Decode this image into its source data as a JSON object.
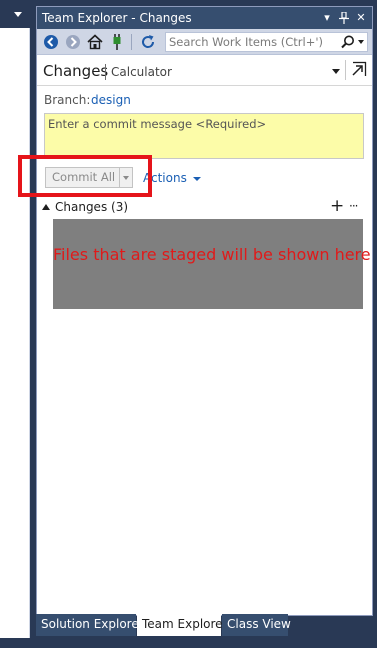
{
  "tool_window": {
    "title": "Team Explorer - Changes",
    "title_buttons": {
      "dropdown": "▾",
      "pin": "⊥",
      "close": "✕"
    }
  },
  "toolbar": {
    "search_placeholder": "Search Work Items (Ctrl+')"
  },
  "header": {
    "title": "Changes",
    "subtitle": "Calculator"
  },
  "branch": {
    "label": "Branch:",
    "name": "design"
  },
  "commit": {
    "placeholder": "Enter a commit message <Required>",
    "button_label": "Commit All",
    "actions_label": "Actions"
  },
  "changes_section": {
    "title": "Changes (3)",
    "add_label": "+",
    "more_label": "···",
    "staged_message": "Files that are staged will be shown here"
  },
  "tabs": [
    {
      "label": "Solution Explorer",
      "active": false
    },
    {
      "label": "Team Explorer",
      "active": true
    },
    {
      "label": "Class View",
      "active": false
    }
  ],
  "colors": {
    "title_bar": "#364e6f",
    "frame_bg": "#293955",
    "commit_box_bg": "#fcfca8",
    "highlight": "#e5141a",
    "staged_area": "#7f7f7f",
    "staged_text": "#e01a1a",
    "link": "#1a5fb4"
  },
  "icons": [
    "back-icon",
    "forward-icon",
    "home-icon",
    "connect-icon",
    "refresh-icon",
    "search-icon",
    "undock-icon"
  ]
}
